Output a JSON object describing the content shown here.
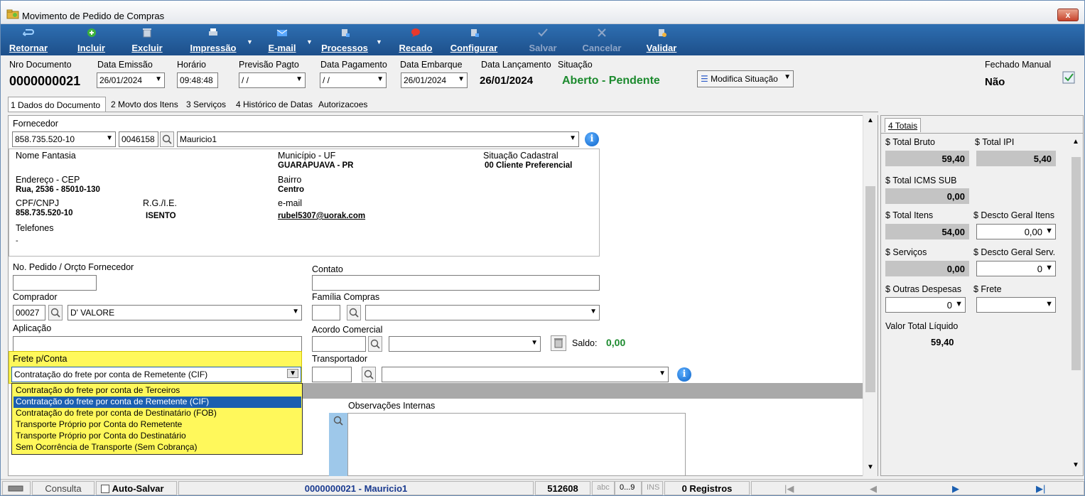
{
  "window": {
    "title": "Movimento de Pedido de Compras",
    "close_label": "x"
  },
  "toolbar": {
    "retornar": "Retornar",
    "incluir": "Incluir",
    "excluir": "Excluir",
    "impressao": "Impressão",
    "email": "E-mail",
    "processos": "Processos",
    "recado": "Recado",
    "configurar": "Configurar",
    "salvar": "Salvar",
    "cancelar": "Cancelar",
    "validar": "Validar"
  },
  "header": {
    "nro_label": "Nro Documento",
    "nro_value": "0000000021",
    "emissao_label": "Data Emissão",
    "emissao_value": "26/01/2024",
    "horario_label": "Horário",
    "horario_value": "09:48:48",
    "previsao_label": "Previsão Pagto",
    "previsao_value": "/ /",
    "pagamento_label": "Data Pagamento",
    "pagamento_value": "/ /",
    "embarque_label": "Data Embarque",
    "embarque_value": "26/01/2024",
    "lancamento_label": "Data Lançamento",
    "lancamento_value": "26/01/2024",
    "situacao_label": "Situação",
    "situacao_value": "Aberto - Pendente",
    "modifica_label": "Modifica Situação",
    "fechado_label": "Fechado Manual",
    "fechado_value": "Não"
  },
  "tabs": [
    {
      "label": "1 Dados do Documento"
    },
    {
      "label": "2 Movto dos Itens"
    },
    {
      "label": "3 Serviços"
    },
    {
      "label": "4 Histórico de Datas"
    },
    {
      "label": "Autorizacoes"
    }
  ],
  "fornecedor": {
    "label": "Fornecedor",
    "cnpj": "858.735.520-10",
    "codigo": "0046158",
    "nome": "Mauricio1"
  },
  "info": {
    "nome_fantasia_label": "Nome Fantasia",
    "municipio_label": "Município - UF",
    "municipio_value": "GUARAPUAVA - PR",
    "situacao_cad_label": "Situação Cadastral",
    "situacao_cad_value": "00 Cliente Preferencial",
    "endereco_label": "Endereço - CEP",
    "endereco_value": "Rua, 2536 - 85010-130",
    "bairro_label": "Bairro",
    "bairro_value": "Centro",
    "cpf_label": "CPF/CNPJ",
    "cpf_value": "858.735.520-10",
    "rg_label": "R.G./I.E.",
    "rg_value": "ISENTO",
    "email_label": "e-mail",
    "email_value": "rubel5307@uorak.com",
    "telefones_label": "Telefones",
    "telefones_value": "-"
  },
  "form": {
    "pedido_label": "No. Pedido / Orçto Fornecedor",
    "contato_label": "Contato",
    "comprador_label": "Comprador",
    "comprador_code": "00027",
    "comprador_name": "D' VALORE",
    "familia_label": "Família Compras",
    "aplicacao_label": "Aplicação",
    "acordo_label": "Acordo Comercial",
    "saldo_label": "Saldo:",
    "saldo_value": "0,00",
    "frete_label": "Frete p/Conta",
    "frete_value": "Contratação do frete por conta de Remetente (CIF)",
    "transportador_label": "Transportador",
    "obs_internas_label": "Observações Internas"
  },
  "frete_options": [
    "Contratação do frete por conta de Terceiros",
    "Contratação do frete por conta de Remetente (CIF)",
    "Contratação do frete por conta de Destinatário (FOB)",
    "Transporte Próprio por Conta do Remetente",
    "Transporte Próprio por Conta do Destinatário",
    "Sem Ocorrência de Transporte (Sem Cobrança)"
  ],
  "totais": {
    "tab_label": "4 Totais",
    "bruto_label": "$ Total Bruto",
    "bruto_value": "59,40",
    "ipi_label": "$ Total IPI",
    "ipi_value": "5,40",
    "icms_label": "$ Total ICMS SUB",
    "icms_value": "0,00",
    "itens_label": "$ Total Itens",
    "itens_value": "54,00",
    "desc_itens_label": "$ Descto Geral Itens",
    "desc_itens_value": "0,00",
    "servicos_label": "$ Serviços",
    "servicos_value": "0,00",
    "desc_serv_label": "$ Descto Geral Serv.",
    "desc_serv_value": "0",
    "outras_label": "$ Outras Despesas",
    "outras_value": "0",
    "frete_label": "$ Frete",
    "frete_value": "",
    "liquido_label": "Valor Total Líquido",
    "liquido_value": "59,40"
  },
  "status": {
    "consulta": "Consulta",
    "auto_salvar": "Auto-Salvar",
    "documento": "0000000021 - Mauricio1",
    "numero": "512608",
    "abc": "abc",
    "digits": "0...9",
    "ins": "INS",
    "registros": "0 Registros"
  },
  "colors": {
    "toolbar": "#1d4f8a",
    "situacao": "#1c8a2e",
    "frete_highlight": "#fff85b",
    "selection": "#1b5fb0"
  }
}
